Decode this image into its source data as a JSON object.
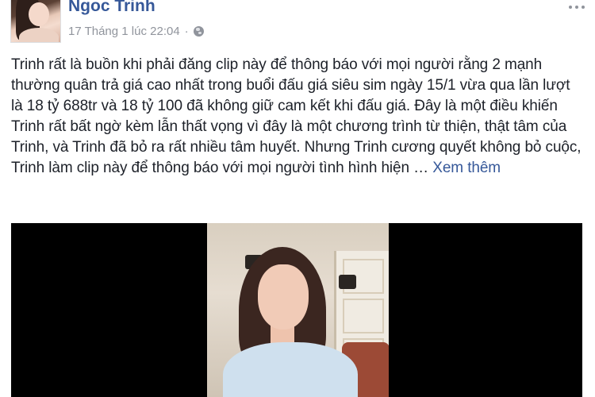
{
  "post": {
    "author": "Ngoc Trinh",
    "timestamp": "17 Tháng 1 lúc 22:04",
    "separator": "·",
    "privacy_icon": "globe-icon",
    "body": "Trinh rất là buồn khi phải đăng clip này để thông báo với mọi người rằng 2 mạnh thường quân trả giá cao nhất trong buổi đấu giá siêu sim ngày 15/1 vừa qua lần lượt là 18 tỷ 688tr và 18 tỷ 100 đã không giữ cam kết khi đấu giá. Đây là một điều khiến Trinh rất bất ngờ kèm lẫn thất vọng vì đây là một chương trình từ thiện, thật tâm của Trinh, và Trinh đã bỏ ra rất nhiều tâm huyết. Nhưng Trinh cương quyết không bỏ cuộc, Trinh làm clip này để thông báo với mọi người tình hình hiện … ",
    "see_more": "Xem thêm"
  },
  "colors": {
    "link": "#365899",
    "meta": "#90949c",
    "text": "#1d2129",
    "video_bg": "#000000"
  }
}
